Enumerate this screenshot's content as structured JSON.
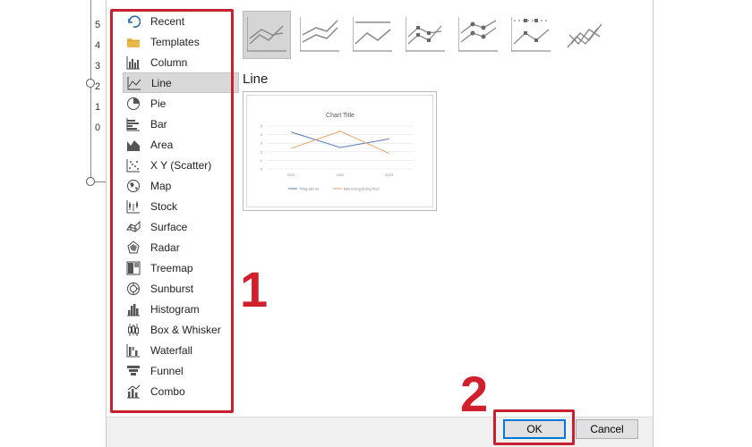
{
  "background": {
    "axis_numbers": [
      "5",
      "4",
      "3",
      "2",
      "1",
      "0"
    ]
  },
  "chart_types": [
    {
      "label": "Recent",
      "icon": "recent-icon"
    },
    {
      "label": "Templates",
      "icon": "folder-icon"
    },
    {
      "label": "Column",
      "icon": "column-chart-icon"
    },
    {
      "label": "Line",
      "icon": "line-chart-icon",
      "selected": true
    },
    {
      "label": "Pie",
      "icon": "pie-chart-icon"
    },
    {
      "label": "Bar",
      "icon": "bar-chart-icon"
    },
    {
      "label": "Area",
      "icon": "area-chart-icon"
    },
    {
      "label": "X Y (Scatter)",
      "icon": "scatter-chart-icon"
    },
    {
      "label": "Map",
      "icon": "map-chart-icon"
    },
    {
      "label": "Stock",
      "icon": "stock-chart-icon"
    },
    {
      "label": "Surface",
      "icon": "surface-chart-icon"
    },
    {
      "label": "Radar",
      "icon": "radar-chart-icon"
    },
    {
      "label": "Treemap",
      "icon": "treemap-chart-icon"
    },
    {
      "label": "Sunburst",
      "icon": "sunburst-chart-icon"
    },
    {
      "label": "Histogram",
      "icon": "histogram-chart-icon"
    },
    {
      "label": "Box & Whisker",
      "icon": "box-whisker-chart-icon"
    },
    {
      "label": "Waterfall",
      "icon": "waterfall-chart-icon"
    },
    {
      "label": "Funnel",
      "icon": "funnel-chart-icon"
    },
    {
      "label": "Combo",
      "icon": "combo-chart-icon"
    }
  ],
  "section_title": "Line",
  "annotations": {
    "one": "1",
    "two": "2"
  },
  "buttons": {
    "ok": "OK",
    "cancel": "Cancel"
  },
  "colors": {
    "annotation_red": "#c8202f",
    "series1": "#5b7bb3",
    "series2": "#e8a36a"
  },
  "preview_chart": {
    "type": "line",
    "title": "Chart Title",
    "categories": [
      "2021",
      "2022",
      "2023"
    ],
    "y_ticks": [
      "5",
      "4",
      "3",
      "2",
      "1",
      "0"
    ],
    "ylim": [
      0,
      5
    ],
    "series": [
      {
        "name": "Tổng dân số",
        "values": [
          4.3,
          2.5,
          3.5
        ]
      },
      {
        "name": "Bản lượng lương thực",
        "values": [
          2.4,
          4.4,
          1.8
        ]
      }
    ]
  }
}
